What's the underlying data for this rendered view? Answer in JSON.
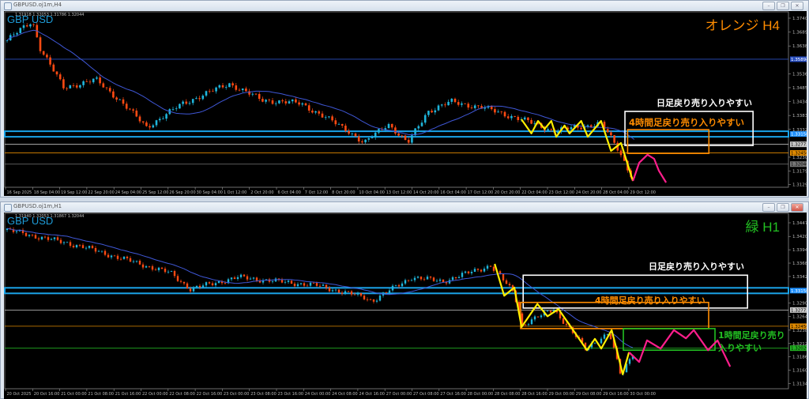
{
  "windows": [
    {
      "title": "GBPUSD.oj1m,H4",
      "ohlc": "1.31918 1.32053 1.31786 1.32044",
      "symbol_label": "GBP USD",
      "corner_label": "オレンジ H4",
      "corner_color": "#ff8c00",
      "buttons": {
        "minimize": "–",
        "restore": "❐",
        "close": "✕"
      },
      "price_ticks": [
        "1.37400",
        "1.36890",
        "1.36380",
        "1.35360",
        "1.34850",
        "1.34340",
        "1.33830",
        "1.33320",
        "1.32300",
        "1.31790",
        "1.31295"
      ],
      "price_tick_values": [
        1.374,
        1.3689,
        1.3638,
        1.3536,
        1.3485,
        1.3434,
        1.3383,
        1.3332,
        1.323,
        1.3179,
        1.31295
      ],
      "levels": [
        {
          "price": 1.35894,
          "label": "1.35894",
          "color": "#2a4fc0",
          "text_color": "#ffffff",
          "style": "line"
        },
        {
          "price": 1.3315,
          "label": "1.33150",
          "color": "#1e90ff",
          "text_color": "#ffffff",
          "style": "band"
        },
        {
          "price": 1.32772,
          "label": "1.32772",
          "color": "#c8c8c8",
          "text_color": "#000000",
          "style": "line"
        },
        {
          "price": 1.32456,
          "label": "1.32456",
          "color": "#e08a00",
          "text_color": "#000000",
          "style": "line"
        },
        {
          "price": 1.32046,
          "label": "1.32046",
          "color": "#777777",
          "text_color": "#000000",
          "style": "line"
        }
      ],
      "time_labels": [
        "16 Sep 2025",
        "18 Sep 04:00",
        "19 Sep 12:00",
        "22 Sep 20:00",
        "24 Sep 04:00",
        "25 Sep 12:00",
        "26 Sep 20:00",
        "30 Sep 04:00",
        "1 Oct 12:00",
        "2 Oct 20:00",
        "6 Oct 04:00",
        "7 Oct 12:00",
        "8 Oct 20:00",
        "10 Oct 04:00",
        "13 Oct 12:00",
        "14 Oct 20:00",
        "16 Oct 04:00",
        "17 Oct 12:00",
        "20 Oct 20:00",
        "22 Oct 04:00",
        "23 Oct 12:00",
        "24 Oct 20:00",
        "28 Oct 04:00",
        "29 Oct 12:00"
      ],
      "bars": 189,
      "price_path": [
        [
          0,
          1.3659
        ],
        [
          7.6,
          1.373
        ],
        [
          10,
          1.363
        ],
        [
          17,
          1.3485
        ],
        [
          26.7,
          1.3514
        ],
        [
          33.8,
          1.3441
        ],
        [
          42,
          1.334
        ],
        [
          53,
          1.3427
        ],
        [
          67,
          1.35
        ],
        [
          76.7,
          1.344
        ],
        [
          88.6,
          1.3427
        ],
        [
          103,
          1.3326
        ],
        [
          107.6,
          1.328
        ],
        [
          114.8,
          1.3354
        ],
        [
          120.7,
          1.328
        ],
        [
          126.7,
          1.3398
        ],
        [
          133.8,
          1.3433
        ],
        [
          143.3,
          1.3412
        ],
        [
          155,
          1.3369
        ],
        [
          164.8,
          1.3326
        ],
        [
          179,
          1.3354
        ],
        [
          183.8,
          1.3267
        ],
        [
          188.6,
          1.3152
        ]
      ],
      "yellow_path": [
        [
          155,
          1.3369
        ],
        [
          158,
          1.3317
        ],
        [
          160,
          1.3363
        ],
        [
          162,
          1.3334
        ],
        [
          164,
          1.3363
        ],
        [
          165.5,
          1.3305
        ],
        [
          168,
          1.3346
        ],
        [
          169.5,
          1.3317
        ],
        [
          173,
          1.3363
        ],
        [
          175,
          1.3305
        ],
        [
          177,
          1.3334
        ],
        [
          179,
          1.3363
        ],
        [
          182,
          1.3253
        ],
        [
          185,
          1.3282
        ],
        [
          188.6,
          1.3143
        ]
      ],
      "pink_path": [
        [
          188.6,
          1.3143
        ],
        [
          190.5,
          1.321
        ],
        [
          193,
          1.3239
        ],
        [
          195,
          1.3224
        ],
        [
          196.4,
          1.3181
        ],
        [
          198.6,
          1.3137
        ]
      ],
      "zones": [
        {
          "name": "daily-zone",
          "color": "#ffffff",
          "bar_from": 186.2,
          "bar_to": 224.8,
          "price_hi": 1.3398,
          "price_lo": 1.3273
        },
        {
          "name": "h4-zone",
          "color": "#ff8c00",
          "bar_from": 187,
          "bar_to": 211.5,
          "price_hi": 1.3331,
          "price_lo": 1.3244
        }
      ],
      "annotations": [
        {
          "text": "日足戻り売り入りやすい",
          "color": "#ffffff"
        },
        {
          "text": "4時間足戻り売り入りやすい",
          "color": "#ff8c00"
        }
      ]
    },
    {
      "title": "GBPUSD.oj1m,H1",
      "ohlc": "1.31940 1.32053 1.31867 1.32044",
      "symbol_label": "GBP USD",
      "corner_label": "緑 H1",
      "corner_color": "#22c022",
      "buttons": {
        "minimize": "–",
        "restore": "❐",
        "close": "✕"
      },
      "price_ticks": [
        "1.34470",
        "1.34205",
        "1.33945",
        "1.33685",
        "1.33425",
        "1.32905",
        "1.32645",
        "1.32380",
        "1.32120",
        "1.31860",
        "1.31600",
        "1.31340"
      ],
      "price_tick_values": [
        1.3447,
        1.34205,
        1.33945,
        1.33685,
        1.33425,
        1.32905,
        1.32645,
        1.3238,
        1.3212,
        1.3186,
        1.316,
        1.3134
      ],
      "levels": [
        {
          "price": 1.3315,
          "label": "1.33150",
          "color": "#1e90ff",
          "text_color": "#ffffff",
          "style": "band"
        },
        {
          "price": 1.32772,
          "label": "1.32772",
          "color": "#c8c8c8",
          "text_color": "#000000",
          "style": "line"
        },
        {
          "price": 1.32456,
          "label": "1.32456",
          "color": "#e08a00",
          "text_color": "#000000",
          "style": "line"
        },
        {
          "price": 1.32029,
          "label": "1.32029",
          "color": "#22b022",
          "text_color": "#000000",
          "style": "line"
        }
      ],
      "time_labels": [
        "20 Oct 2025",
        "20 Oct 16:00",
        "21 Oct 00:00",
        "21 Oct 08:00",
        "21 Oct 16:00",
        "22 Oct 00:00",
        "22 Oct 08:00",
        "22 Oct 16:00",
        "23 Oct 00:00",
        "23 Oct 08:00",
        "23 Oct 16:00",
        "24 Oct 00:00",
        "24 Oct 08:00",
        "24 Oct 16:00",
        "27 Oct 00:00",
        "27 Oct 08:00",
        "27 Oct 16:00",
        "28 Oct 00:00",
        "28 Oct 08:00",
        "28 Oct 16:00",
        "29 Oct 00:00",
        "29 Oct 08:00",
        "29 Oct 16:00",
        "30 Oct 00:00"
      ],
      "bars": 198,
      "price_path": [
        [
          0,
          1.3433
        ],
        [
          23,
          1.3402
        ],
        [
          51.8,
          1.3349
        ],
        [
          58,
          1.3318
        ],
        [
          73,
          1.3341
        ],
        [
          98,
          1.3325
        ],
        [
          113,
          1.3302
        ],
        [
          115.5,
          1.3295
        ],
        [
          128,
          1.3341
        ],
        [
          138,
          1.3333
        ],
        [
          153,
          1.3364
        ],
        [
          160.5,
          1.331
        ],
        [
          163,
          1.3248
        ],
        [
          173,
          1.3279
        ],
        [
          183,
          1.3202
        ],
        [
          190.5,
          1.3233
        ],
        [
          194.3,
          1.3148
        ],
        [
          198,
          1.3195
        ]
      ],
      "yellow_path": [
        [
          154.3,
          1.3367
        ],
        [
          157.3,
          1.3305
        ],
        [
          160.5,
          1.3321
        ],
        [
          162.8,
          1.3244
        ],
        [
          167.8,
          1.3289
        ],
        [
          171,
          1.3265
        ],
        [
          174.5,
          1.3279
        ],
        [
          178,
          1.3248
        ],
        [
          183.5,
          1.3199
        ],
        [
          186,
          1.3221
        ],
        [
          188,
          1.3202
        ],
        [
          191.3,
          1.3238
        ],
        [
          193,
          1.3198
        ],
        [
          194.8,
          1.3152
        ],
        [
          196.8,
          1.3195
        ]
      ],
      "pink_path": [
        [
          196.8,
          1.3195
        ],
        [
          200,
          1.3176
        ],
        [
          202.5,
          1.3218
        ],
        [
          206.8,
          1.3202
        ],
        [
          211,
          1.3238
        ],
        [
          214.8,
          1.3222
        ],
        [
          217.3,
          1.3238
        ],
        [
          221.8,
          1.3199
        ],
        [
          224.8,
          1.3218
        ],
        [
          228.8,
          1.3167
        ]
      ],
      "zones": [
        {
          "name": "daily-zone",
          "color": "#ffffff",
          "bar_from": 163.3,
          "bar_to": 234.3,
          "price_hi": 1.3345,
          "price_lo": 1.3281
        },
        {
          "name": "h4-zone",
          "color": "#ff8c00",
          "bar_from": 162.5,
          "bar_to": 222,
          "price_hi": 1.3292,
          "price_lo": 1.3241
        },
        {
          "name": "h1-zone",
          "color": "#22c022",
          "bar_from": 195,
          "bar_to": 224,
          "price_hi": 1.3241,
          "price_lo": 1.3199
        }
      ],
      "annotations": [
        {
          "text": "日足戻り売り入りやすい",
          "color": "#ffffff"
        },
        {
          "text": "4時間足戻り売り入りやすい",
          "color": "#ff8c00"
        },
        {
          "text": "1時間足戻り売り",
          "color": "#22c022"
        },
        {
          "text": "入りやすい",
          "color": "#22c022"
        }
      ]
    }
  ],
  "colors": {
    "up": "#1fb6dc",
    "down": "#ff4a12",
    "ma": "#3f57d6",
    "yellow": "#ffee00",
    "pink": "#ff1e8c"
  }
}
